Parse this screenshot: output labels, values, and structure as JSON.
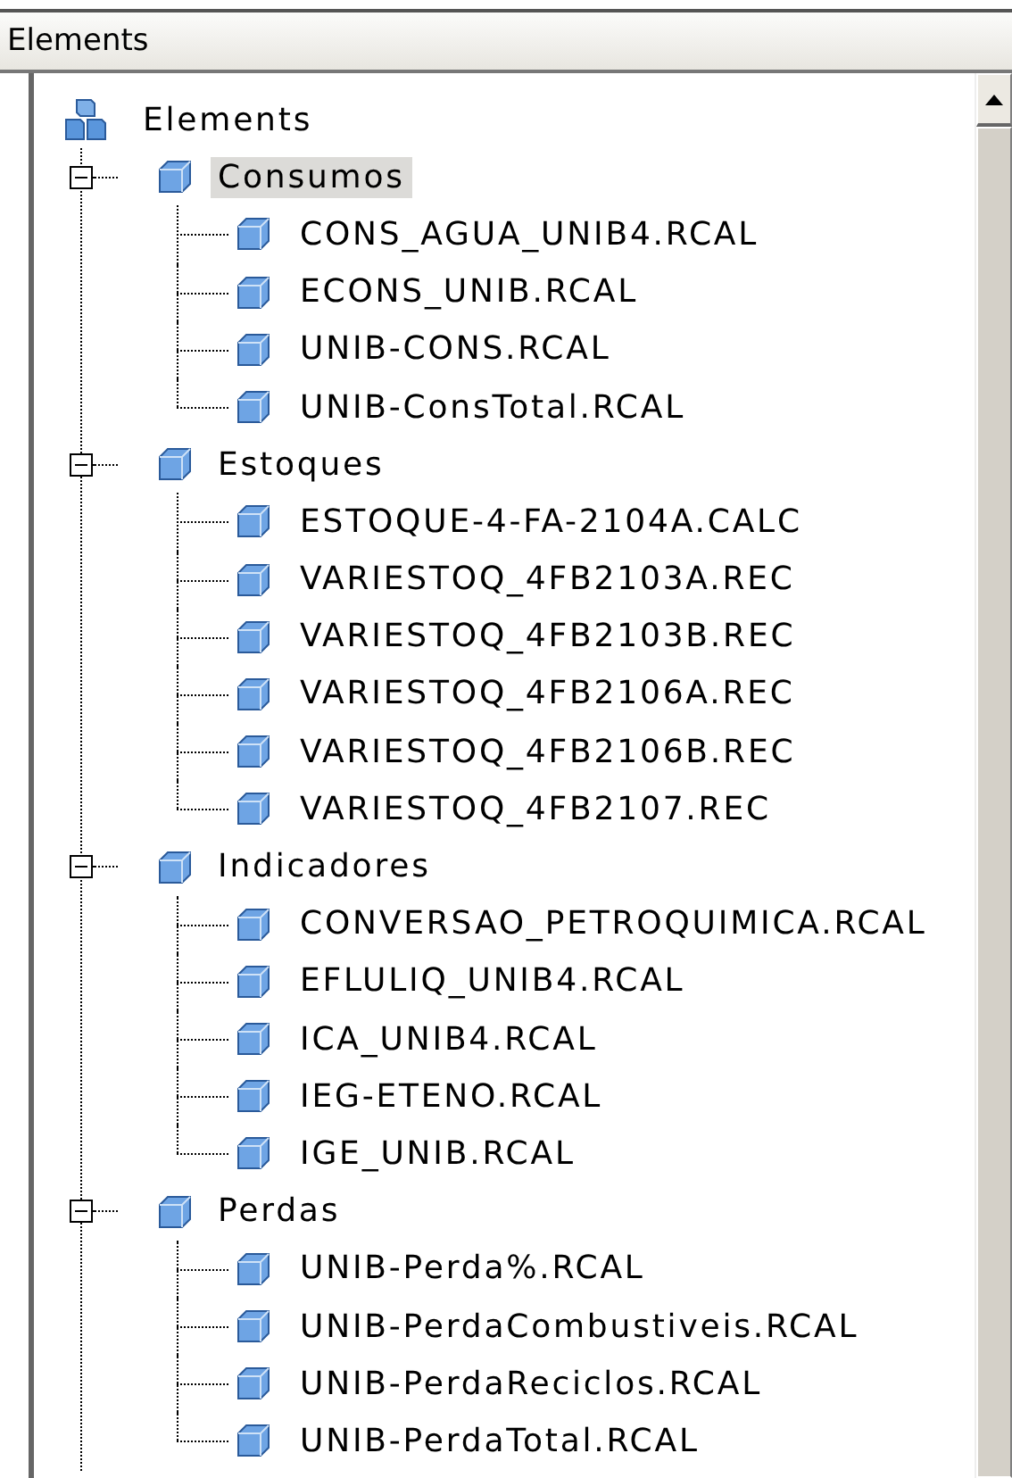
{
  "panel": {
    "title": "Elements"
  },
  "tree": {
    "label": "Elements",
    "children": [
      {
        "label": "Consumos",
        "expanded": true,
        "selected": true,
        "children": [
          {
            "label": "CONS_AGUA_UNIB4.RCAL"
          },
          {
            "label": "ECONS_UNIB.RCAL"
          },
          {
            "label": "UNIB-CONS.RCAL"
          },
          {
            "label": "UNIB-ConsTotal.RCAL"
          }
        ]
      },
      {
        "label": "Estoques",
        "expanded": true,
        "selected": false,
        "children": [
          {
            "label": "ESTOQUE-4-FA-2104A.CALC"
          },
          {
            "label": "VARIESTOQ_4FB2103A.REC"
          },
          {
            "label": "VARIESTOQ_4FB2103B.REC"
          },
          {
            "label": "VARIESTOQ_4FB2106A.REC"
          },
          {
            "label": "VARIESTOQ_4FB2106B.REC"
          },
          {
            "label": "VARIESTOQ_4FB2107.REC"
          }
        ]
      },
      {
        "label": "Indicadores",
        "expanded": true,
        "selected": false,
        "children": [
          {
            "label": "CONVERSAO_PETROQUIMICA.RCAL"
          },
          {
            "label": "EFLULIQ_UNIB4.RCAL"
          },
          {
            "label": "ICA_UNIB4.RCAL"
          },
          {
            "label": "IEG-ETENO.RCAL"
          },
          {
            "label": "IGE_UNIB.RCAL"
          }
        ]
      },
      {
        "label": "Perdas",
        "expanded": true,
        "selected": false,
        "children": [
          {
            "label": "UNIB-Perda%.RCAL"
          },
          {
            "label": "UNIB-PerdaCombustiveis.RCAL"
          },
          {
            "label": "UNIB-PerdaReciclos.RCAL"
          },
          {
            "label": "UNIB-PerdaTotal.RCAL"
          }
        ]
      }
    ]
  }
}
